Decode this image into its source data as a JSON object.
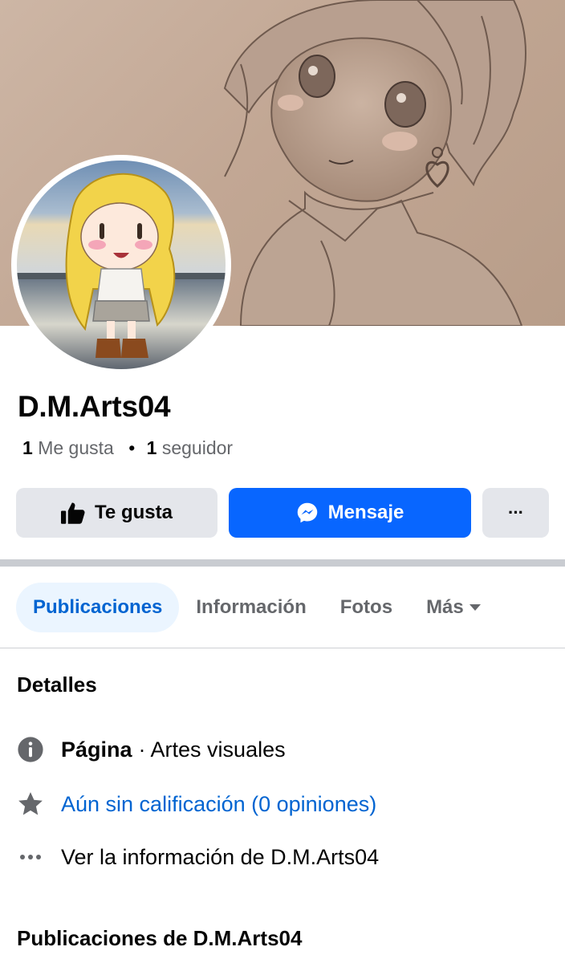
{
  "page": {
    "name": "D.M.Arts04",
    "likes_count": "1",
    "likes_label": "Me gusta",
    "followers_count": "1",
    "followers_label": "seguidor"
  },
  "actions": {
    "like_label": "Te gusta",
    "message_label": "Mensaje",
    "more_label": "···"
  },
  "tabs": [
    {
      "label": "Publicaciones",
      "active": true
    },
    {
      "label": "Información",
      "active": false
    },
    {
      "label": "Fotos",
      "active": false
    },
    {
      "label": "Más",
      "active": false
    }
  ],
  "details": {
    "title": "Detalles",
    "category_prefix": "Página",
    "category_value": "· Artes visuales",
    "rating_text": "Aún sin calificación (0 opiniones)",
    "see_info_text": "Ver la información de D.M.Arts04"
  },
  "posts_section": {
    "title": "Publicaciones de D.M.Arts04"
  },
  "colors": {
    "accent": "#0866ff",
    "link": "#0064d1",
    "secondary_button": "#e4e6eb",
    "tab_active_bg": "#ebf5ff"
  },
  "icons": {
    "like": "thumbs-up-icon",
    "message": "messenger-icon",
    "more": "more-dots-icon",
    "info": "info-circle-icon",
    "rating": "star-icon",
    "see_more": "ellipsis-icon",
    "tab_caret": "caret-down-icon"
  }
}
